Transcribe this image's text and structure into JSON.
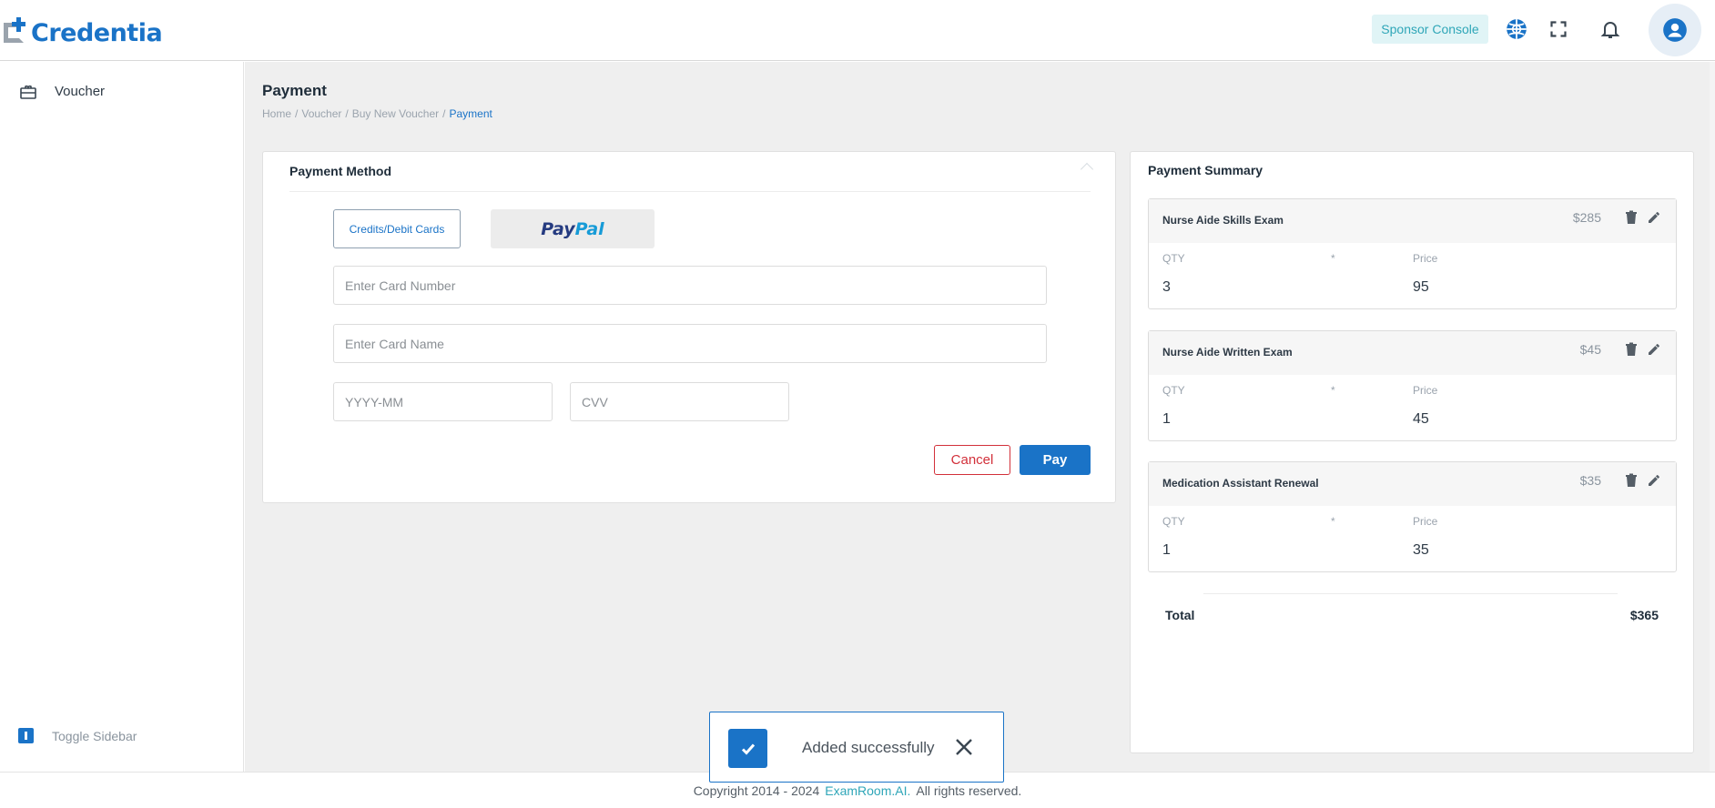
{
  "header": {
    "logo_text": "Credentia",
    "sponsor_console_label": "Sponsor Console",
    "icons": [
      "globe-icon",
      "fullscreen-icon",
      "bell-icon",
      "account-icon"
    ]
  },
  "sidebar": {
    "items": [
      {
        "label": "Voucher",
        "icon": "voucher-icon"
      }
    ],
    "toggle_label": "Toggle Sidebar"
  },
  "page": {
    "title": "Payment",
    "breadcrumb": [
      "Home",
      "Voucher",
      "Buy New Voucher",
      "Payment"
    ],
    "breadcrumb_sep": "/"
  },
  "payment_method": {
    "title": "Payment Method",
    "tab_cards_label": "Credits/Debit Cards",
    "tab_paypal_part1": "Pay",
    "tab_paypal_part2": "Pal",
    "card_number_placeholder": "Enter Card Number",
    "card_name_placeholder": "Enter Card Name",
    "expiry_placeholder": "YYYY-MM",
    "cvv_placeholder": "CVV",
    "cancel_label": "Cancel",
    "pay_label": "Pay"
  },
  "payment_summary": {
    "title": "Payment Summary",
    "qty_label": "QTY",
    "times_symbol": "*",
    "price_label": "Price",
    "items": [
      {
        "name": "Nurse Aide Skills Exam",
        "amount": "$285",
        "qty": "3",
        "price": "95"
      },
      {
        "name": "Nurse Aide Written Exam",
        "amount": "$45",
        "qty": "1",
        "price": "45"
      },
      {
        "name": "Medication Assistant Renewal",
        "amount": "$35",
        "qty": "1",
        "price": "35"
      }
    ],
    "total_label": "Total",
    "total_value": "$365"
  },
  "toast": {
    "message": "Added successfully"
  },
  "footer": {
    "copyright": "Copyright 2014 - 2024",
    "link": "ExamRoom.AI.",
    "rights": "All rights reserved."
  },
  "colors": {
    "primary": "#1a73c7",
    "danger": "#d2303a",
    "teal": "#2fa6b8",
    "background": "#efefef"
  }
}
